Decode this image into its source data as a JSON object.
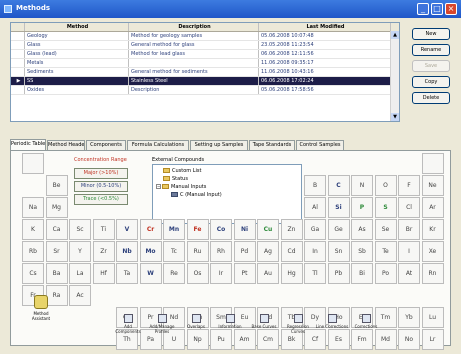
{
  "window": {
    "title": "Methods",
    "buttons": {
      "minimize": "_",
      "maximize": "□",
      "close": "×"
    }
  },
  "methods_grid": {
    "columns": [
      "",
      "Method",
      "Description",
      "Last Modified"
    ],
    "rows": [
      {
        "indicator": "",
        "method": "Geology",
        "description": "Method for geology samples",
        "modified": "05.06.2008 10:07:48",
        "selected": false
      },
      {
        "indicator": "",
        "method": "Glass",
        "description": "General method for glass",
        "modified": "23.05.2008 11:23:54",
        "selected": false
      },
      {
        "indicator": "",
        "method": "Glass (lead)",
        "description": "Method for lead glass",
        "modified": "06.06.2008 12:11:56",
        "selected": false
      },
      {
        "indicator": "",
        "method": "Metals",
        "description": "",
        "modified": "11.06.2008 09:35:17",
        "selected": false
      },
      {
        "indicator": "",
        "method": "Sediments",
        "description": "General method for sediments",
        "modified": "11.06.2008 10:43:16",
        "selected": false
      },
      {
        "indicator": "▶",
        "method": "SS",
        "description": "Stainless Steel",
        "modified": "06.06.2008 17:02:24",
        "selected": true
      },
      {
        "indicator": "",
        "method": "Oxides",
        "description": "Description",
        "modified": "05.06.2008 17:58:56",
        "selected": false
      }
    ],
    "scroll_up": "▲",
    "scroll_down": "▼"
  },
  "side_buttons": [
    {
      "label": "New",
      "enabled": true
    },
    {
      "label": "Rename",
      "enabled": true
    },
    {
      "label": "Save",
      "enabled": false
    },
    {
      "label": "Copy",
      "enabled": true
    },
    {
      "label": "Delete",
      "enabled": true
    }
  ],
  "tabs": [
    "Periodic Table",
    "Method Header",
    "Components",
    "Formula Calculations",
    "Setting up Samples",
    "Tape Standards",
    "Control Samples"
  ],
  "periodic": {
    "concentration_label": "Concentration Range",
    "range_buttons": [
      {
        "label": "Major (>10%)",
        "color": "#c03020"
      },
      {
        "label": "Minor (0.5-10%)",
        "color": "#2c3f7a"
      },
      {
        "label": "Trace (<0.5%)",
        "color": "#2e8b3a"
      }
    ],
    "external_label": "External Compounds",
    "tree": {
      "custom": "Custom List",
      "status": "Status",
      "manual": "Manual Inputs",
      "manual_child": "C (Manual Input)",
      "expander_open": "−",
      "expander_closed": "+"
    },
    "elements": [
      {
        "s": "",
        "r": 0,
        "c": 0
      },
      {
        "s": "",
        "r": 0,
        "c": 17
      },
      {
        "s": "Be",
        "r": 1,
        "c": 1
      },
      {
        "s": "B",
        "r": 1,
        "c": 12
      },
      {
        "s": "C",
        "r": 1,
        "c": 13,
        "color": "#2c3f7a",
        "bold": true
      },
      {
        "s": "N",
        "r": 1,
        "c": 14
      },
      {
        "s": "O",
        "r": 1,
        "c": 15
      },
      {
        "s": "F",
        "r": 1,
        "c": 16
      },
      {
        "s": "Ne",
        "r": 1,
        "c": 17
      },
      {
        "s": "Na",
        "r": 2,
        "c": 0
      },
      {
        "s": "Mg",
        "r": 2,
        "c": 1
      },
      {
        "s": "Al",
        "r": 2,
        "c": 12
      },
      {
        "s": "Si",
        "r": 2,
        "c": 13,
        "color": "#2c3f7a",
        "bold": true
      },
      {
        "s": "P",
        "r": 2,
        "c": 14,
        "color": "#2e8b3a",
        "bold": true
      },
      {
        "s": "S",
        "r": 2,
        "c": 15,
        "color": "#2e8b3a",
        "bold": true
      },
      {
        "s": "Cl",
        "r": 2,
        "c": 16
      },
      {
        "s": "Ar",
        "r": 2,
        "c": 17
      },
      {
        "s": "K",
        "r": 3,
        "c": 0
      },
      {
        "s": "Ca",
        "r": 3,
        "c": 1
      },
      {
        "s": "Sc",
        "r": 3,
        "c": 2
      },
      {
        "s": "Ti",
        "r": 3,
        "c": 3
      },
      {
        "s": "V",
        "r": 3,
        "c": 4,
        "color": "#2c3f7a",
        "bold": true
      },
      {
        "s": "Cr",
        "r": 3,
        "c": 5,
        "color": "#c03020",
        "bold": true
      },
      {
        "s": "Mn",
        "r": 3,
        "c": 6,
        "color": "#2c3f7a",
        "bold": true
      },
      {
        "s": "Fe",
        "r": 3,
        "c": 7,
        "color": "#c03020",
        "bold": true
      },
      {
        "s": "Co",
        "r": 3,
        "c": 8,
        "color": "#2c3f7a",
        "bold": true
      },
      {
        "s": "Ni",
        "r": 3,
        "c": 9,
        "color": "#2c3f7a",
        "bold": true
      },
      {
        "s": "Cu",
        "r": 3,
        "c": 10,
        "color": "#2e8b3a",
        "bold": true
      },
      {
        "s": "Zn",
        "r": 3,
        "c": 11
      },
      {
        "s": "Ga",
        "r": 3,
        "c": 12
      },
      {
        "s": "Ge",
        "r": 3,
        "c": 13
      },
      {
        "s": "As",
        "r": 3,
        "c": 14
      },
      {
        "s": "Se",
        "r": 3,
        "c": 15
      },
      {
        "s": "Br",
        "r": 3,
        "c": 16
      },
      {
        "s": "Kr",
        "r": 3,
        "c": 17
      },
      {
        "s": "Rb",
        "r": 4,
        "c": 0
      },
      {
        "s": "Sr",
        "r": 4,
        "c": 1
      },
      {
        "s": "Y",
        "r": 4,
        "c": 2
      },
      {
        "s": "Zr",
        "r": 4,
        "c": 3
      },
      {
        "s": "Nb",
        "r": 4,
        "c": 4,
        "color": "#2c3f7a",
        "bold": true
      },
      {
        "s": "Mo",
        "r": 4,
        "c": 5,
        "color": "#2c3f7a",
        "bold": true
      },
      {
        "s": "Tc",
        "r": 4,
        "c": 6
      },
      {
        "s": "Ru",
        "r": 4,
        "c": 7
      },
      {
        "s": "Rh",
        "r": 4,
        "c": 8
      },
      {
        "s": "Pd",
        "r": 4,
        "c": 9
      },
      {
        "s": "Ag",
        "r": 4,
        "c": 10
      },
      {
        "s": "Cd",
        "r": 4,
        "c": 11
      },
      {
        "s": "In",
        "r": 4,
        "c": 12
      },
      {
        "s": "Sn",
        "r": 4,
        "c": 13
      },
      {
        "s": "Sb",
        "r": 4,
        "c": 14
      },
      {
        "s": "Te",
        "r": 4,
        "c": 15
      },
      {
        "s": "I",
        "r": 4,
        "c": 16
      },
      {
        "s": "Xe",
        "r": 4,
        "c": 17
      },
      {
        "s": "Cs",
        "r": 5,
        "c": 0
      },
      {
        "s": "Ba",
        "r": 5,
        "c": 1
      },
      {
        "s": "La",
        "r": 5,
        "c": 2
      },
      {
        "s": "Hf",
        "r": 5,
        "c": 3
      },
      {
        "s": "Ta",
        "r": 5,
        "c": 4
      },
      {
        "s": "W",
        "r": 5,
        "c": 5,
        "color": "#2c3f7a",
        "bold": true
      },
      {
        "s": "Re",
        "r": 5,
        "c": 6
      },
      {
        "s": "Os",
        "r": 5,
        "c": 7
      },
      {
        "s": "Ir",
        "r": 5,
        "c": 8
      },
      {
        "s": "Pt",
        "r": 5,
        "c": 9
      },
      {
        "s": "Au",
        "r": 5,
        "c": 10
      },
      {
        "s": "Hg",
        "r": 5,
        "c": 11
      },
      {
        "s": "Tl",
        "r": 5,
        "c": 12
      },
      {
        "s": "Pb",
        "r": 5,
        "c": 13
      },
      {
        "s": "Bi",
        "r": 5,
        "c": 14
      },
      {
        "s": "Po",
        "r": 5,
        "c": 15
      },
      {
        "s": "At",
        "r": 5,
        "c": 16
      },
      {
        "s": "Rn",
        "r": 5,
        "c": 17
      },
      {
        "s": "Fr",
        "r": 6,
        "c": 0
      },
      {
        "s": "Ra",
        "r": 6,
        "c": 1
      },
      {
        "s": "Ac",
        "r": 6,
        "c": 2
      },
      {
        "s": "Ce",
        "r": 7,
        "c": 4
      },
      {
        "s": "Pr",
        "r": 7,
        "c": 5
      },
      {
        "s": "Nd",
        "r": 7,
        "c": 6
      },
      {
        "s": "Pm",
        "r": 7,
        "c": 7
      },
      {
        "s": "Sm",
        "r": 7,
        "c": 8
      },
      {
        "s": "Eu",
        "r": 7,
        "c": 9
      },
      {
        "s": "Gd",
        "r": 7,
        "c": 10
      },
      {
        "s": "Tb",
        "r": 7,
        "c": 11
      },
      {
        "s": "Dy",
        "r": 7,
        "c": 12
      },
      {
        "s": "Ho",
        "r": 7,
        "c": 13
      },
      {
        "s": "Er",
        "r": 7,
        "c": 14
      },
      {
        "s": "Tm",
        "r": 7,
        "c": 15
      },
      {
        "s": "Yb",
        "r": 7,
        "c": 16
      },
      {
        "s": "Lu",
        "r": 7,
        "c": 17
      },
      {
        "s": "Th",
        "r": 8,
        "c": 4
      },
      {
        "s": "Pa",
        "r": 8,
        "c": 5
      },
      {
        "s": "U",
        "r": 8,
        "c": 6
      },
      {
        "s": "Np",
        "r": 8,
        "c": 7
      },
      {
        "s": "Pu",
        "r": 8,
        "c": 8
      },
      {
        "s": "Am",
        "r": 8,
        "c": 9
      },
      {
        "s": "Cm",
        "r": 8,
        "c": 10
      },
      {
        "s": "Bk",
        "r": 8,
        "c": 11
      },
      {
        "s": "Cf",
        "r": 8,
        "c": 12
      },
      {
        "s": "Es",
        "r": 8,
        "c": 13
      },
      {
        "s": "Fm",
        "r": 8,
        "c": 14
      },
      {
        "s": "Md",
        "r": 8,
        "c": 15
      },
      {
        "s": "No",
        "r": 8,
        "c": 16
      },
      {
        "s": "Lr",
        "r": 8,
        "c": 17
      }
    ]
  },
  "wizard": {
    "label": "Method Assistant",
    "icon": "wand-icon"
  },
  "bottom_actions": [
    {
      "label": "Add Components",
      "icon": "flask-icon"
    },
    {
      "label": "Add/Manage Profiles",
      "icon": "profile-icon"
    },
    {
      "label": "Overlaps",
      "icon": "overlap-icon"
    },
    {
      "label": "Information",
      "icon": "info-icon"
    },
    {
      "label": "Base Curves",
      "icon": "curve-icon"
    },
    {
      "label": "Regression Curves",
      "icon": "regression-icon"
    },
    {
      "label": "Line Corrections",
      "icon": "line-icon"
    },
    {
      "label": "Corrections",
      "icon": "correction-icon"
    }
  ]
}
